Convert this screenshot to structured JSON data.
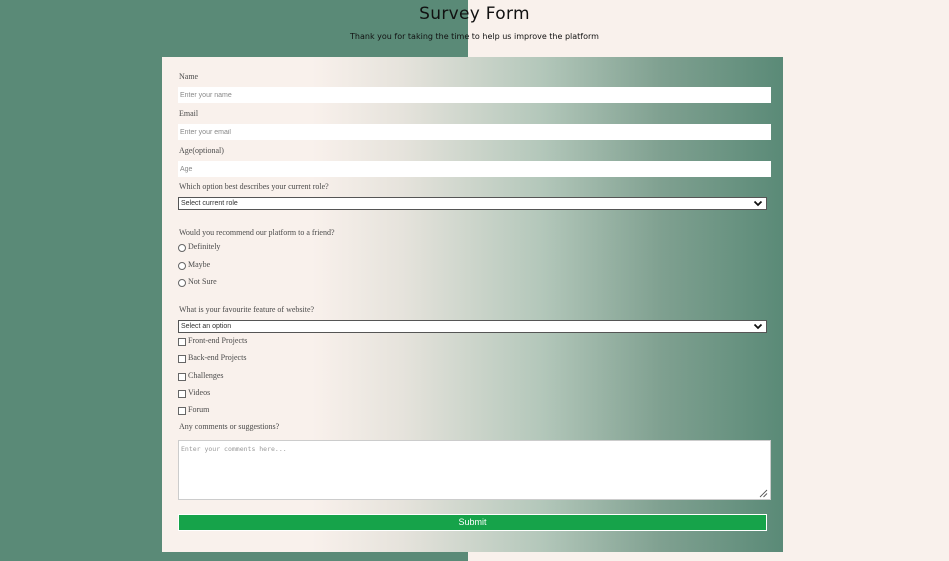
{
  "header": {
    "title": "Survey Form",
    "subtitle": "Thank you for taking the time to help us improve the platform"
  },
  "form": {
    "name": {
      "label": "Name",
      "placeholder": "Enter your name"
    },
    "email": {
      "label": "Email",
      "placeholder": "Enter your email"
    },
    "age": {
      "label": "Age(optional)",
      "placeholder": "Age"
    },
    "role": {
      "label": "Which option best describes your current role?",
      "selected": "Select current role"
    },
    "recommend": {
      "label": "Would you recommend our platform to a friend?",
      "options": [
        "Definitely",
        "Maybe",
        "Not Sure"
      ]
    },
    "feature": {
      "label": "What is your favourite feature of website?",
      "selected": "Select an option",
      "options": [
        "Front-end Projects",
        "Back-end Projects",
        "Challenges",
        "Videos",
        "Forum"
      ]
    },
    "comments": {
      "label": "Any comments or suggestions?",
      "placeholder": "Enter your comments here..."
    },
    "submit_label": "Submit"
  },
  "colors": {
    "left_background": "#5a8a77",
    "right_background": "#f9f1ec",
    "submit_button": "#16a34a"
  }
}
